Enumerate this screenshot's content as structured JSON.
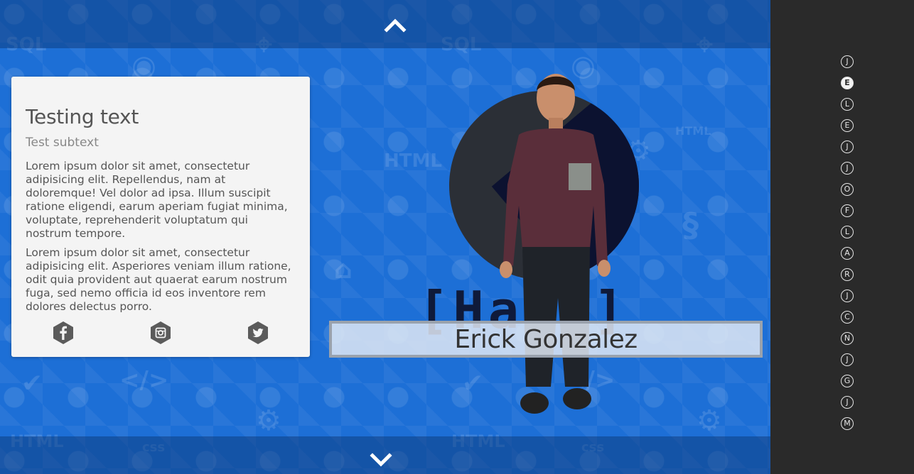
{
  "navigation": {
    "up_label": "",
    "down_label": ""
  },
  "card": {
    "title": "Testing text",
    "subtitle": "Test subtext",
    "paragraph_1": "Lorem ipsum dolor sit amet, consectetur adipisicing elit. Repellendus, nam at doloremque! Vel dolor ad ipsa. Illum suscipit ratione eligendi, earum aperiam fugiat minima, voluptate, reprehenderit voluptatum qui nostrum tempore.",
    "paragraph_2": "Lorem ipsum dolor sit amet, consectetur adipisicing elit. Asperiores veniam illum ratione, odit quia provident aut quaerat earum nostrum fuga, sed nemo officia id eos inventore rem dolores delectus porro.",
    "socials": [
      {
        "icon": "facebook-icon"
      },
      {
        "icon": "instagram-icon"
      },
      {
        "icon": "twitter-icon"
      }
    ]
  },
  "hero": {
    "name": "Erick Gonzalez",
    "logo_text": "[Hack]"
  },
  "sidebar": {
    "dots": [
      {
        "letter": "J",
        "active": false
      },
      {
        "letter": "E",
        "active": true
      },
      {
        "letter": "L",
        "active": false
      },
      {
        "letter": "E",
        "active": false
      },
      {
        "letter": "J",
        "active": false
      },
      {
        "letter": "J",
        "active": false
      },
      {
        "letter": "O",
        "active": false
      },
      {
        "letter": "F",
        "active": false
      },
      {
        "letter": "L",
        "active": false
      },
      {
        "letter": "A",
        "active": false
      },
      {
        "letter": "R",
        "active": false
      },
      {
        "letter": "J",
        "active": false
      },
      {
        "letter": "C",
        "active": false
      },
      {
        "letter": "N",
        "active": false
      },
      {
        "letter": "J",
        "active": false
      },
      {
        "letter": "G",
        "active": false
      },
      {
        "letter": "J",
        "active": false
      },
      {
        "letter": "M",
        "active": false
      }
    ]
  },
  "colors": {
    "stage_blue": "#1d6fd6",
    "sidebar_bg": "#2a2a2a",
    "card_bg": "#f4f4f4"
  }
}
